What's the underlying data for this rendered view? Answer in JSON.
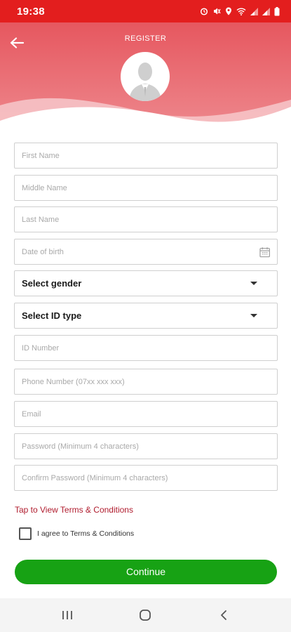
{
  "status_bar": {
    "time": "19:38",
    "icons": [
      "alarm-icon",
      "mute-icon",
      "location-icon",
      "wifi-icon",
      "signal-icon",
      "signal-icon",
      "battery-icon"
    ]
  },
  "header": {
    "title": "REGISTER",
    "back_icon": "arrow-left-icon",
    "avatar_icon": "user-silhouette-icon"
  },
  "form": {
    "first_name": {
      "placeholder": "First Name",
      "value": ""
    },
    "middle_name": {
      "placeholder": "Middle Name",
      "value": ""
    },
    "last_name": {
      "placeholder": "Last Name",
      "value": ""
    },
    "date_of_birth": {
      "placeholder": "Date of birth",
      "value": "",
      "icon": "calendar-icon"
    },
    "gender": {
      "selected": "Select gender"
    },
    "id_type": {
      "selected": "Select ID type"
    },
    "id_number": {
      "placeholder": "ID Number",
      "value": ""
    },
    "phone": {
      "placeholder": "Phone Number (07xx xxx xxx)",
      "value": ""
    },
    "email": {
      "placeholder": "Email",
      "value": ""
    },
    "password": {
      "placeholder": "Password (Minimum 4 characters)",
      "value": ""
    },
    "confirm_password": {
      "placeholder": "Confirm Password (Minimum 4 characters)",
      "value": ""
    }
  },
  "terms": {
    "link_text": "Tap to View Terms & Conditions",
    "agree_label": "I agree to Terms & Conditions",
    "checked": false
  },
  "actions": {
    "continue_label": "Continue"
  },
  "nav_bar": {
    "icons": [
      "recent-apps-icon",
      "home-icon",
      "back-icon"
    ]
  },
  "colors": {
    "status_bar": "#e31e1e",
    "header": "#e8646e",
    "link": "#b01c2e",
    "button": "#17a214"
  }
}
